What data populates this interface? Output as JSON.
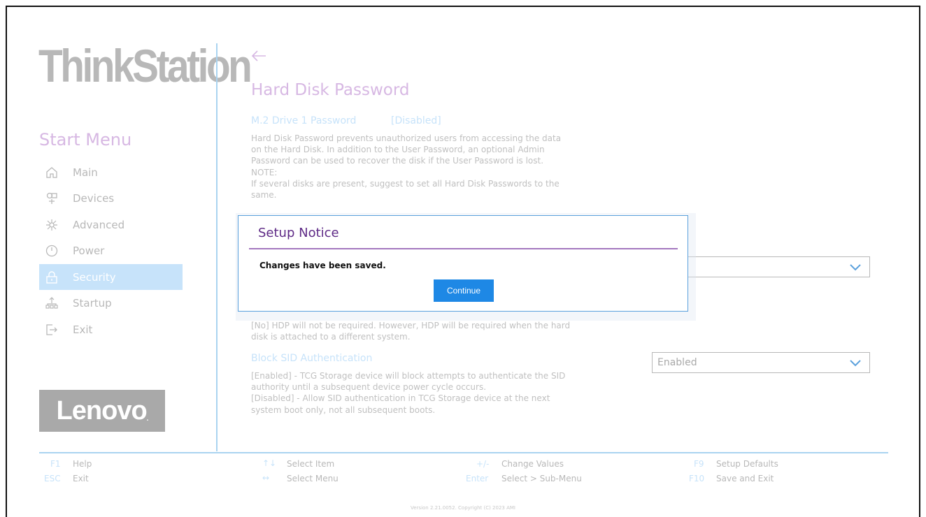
{
  "brand": {
    "name": "ThinkStation",
    "trademark": "."
  },
  "sidebar": {
    "title": "Start Menu",
    "items": [
      {
        "label": "Main",
        "icon": "home-icon"
      },
      {
        "label": "Devices",
        "icon": "devices-icon"
      },
      {
        "label": "Advanced",
        "icon": "advanced-icon"
      },
      {
        "label": "Power",
        "icon": "power-icon"
      },
      {
        "label": "Security",
        "icon": "lock-icon",
        "active": true
      },
      {
        "label": "Startup",
        "icon": "startup-icon"
      },
      {
        "label": "Exit",
        "icon": "exit-icon"
      }
    ],
    "logo": "Lenovo",
    "logo_mark": "."
  },
  "main": {
    "title": "Hard Disk Password",
    "m2_drive": {
      "label": "M.2 Drive 1 Password",
      "value": "[Disabled]"
    },
    "m2_desc": "Hard Disk Password prevents unauthorized users from accessing the data\non the Hard Disk. In addition to the User Password, an optional Admin\nPassword can be used to recover the disk if the User Password is lost.\nNOTE:\nIf several disks are present, suggest to set all Hard Disk Passwords to the\nsame.",
    "hdp_desc": "[No] HDP will not be required. However, HDP will be required when the hard\ndisk is attached to a different system.",
    "block_sid": {
      "label": "Block SID Authentication",
      "value": "Enabled",
      "desc": "[Enabled] - TCG Storage device will block attempts to authenticate the SID\nauthority until a subsequent device power cycle occurs.\n[Disabled] - Allow SID authentication in TCG Storage device at the next\nsystem boot only, not all subsequent boots."
    },
    "hidden_dropdown_value": ""
  },
  "dialog": {
    "title": "Setup Notice",
    "message": "Changes have been saved.",
    "continue_label": "Continue"
  },
  "footer": {
    "keys": [
      {
        "key": "F1",
        "desc": "Help"
      },
      {
        "key": "ESC",
        "desc": "Exit"
      },
      {
        "key": "↑↓",
        "desc": "Select Item"
      },
      {
        "key": "↔",
        "desc": "Select Menu"
      },
      {
        "key": "+/-",
        "desc": "Change Values"
      },
      {
        "key": "Enter",
        "desc": "Select > Sub-Menu"
      },
      {
        "key": "F9",
        "desc": "Setup Defaults"
      },
      {
        "key": "F10",
        "desc": "Save and Exit"
      }
    ],
    "version": "Version 2.21.0052. Copyright (C) 2023 AMI"
  },
  "colors": {
    "accent_blue": "#1e88e5",
    "active_nav": "#c7e3fa",
    "dialog_title": "#5e2a86",
    "heading_lavender": "#d7b8e3"
  }
}
